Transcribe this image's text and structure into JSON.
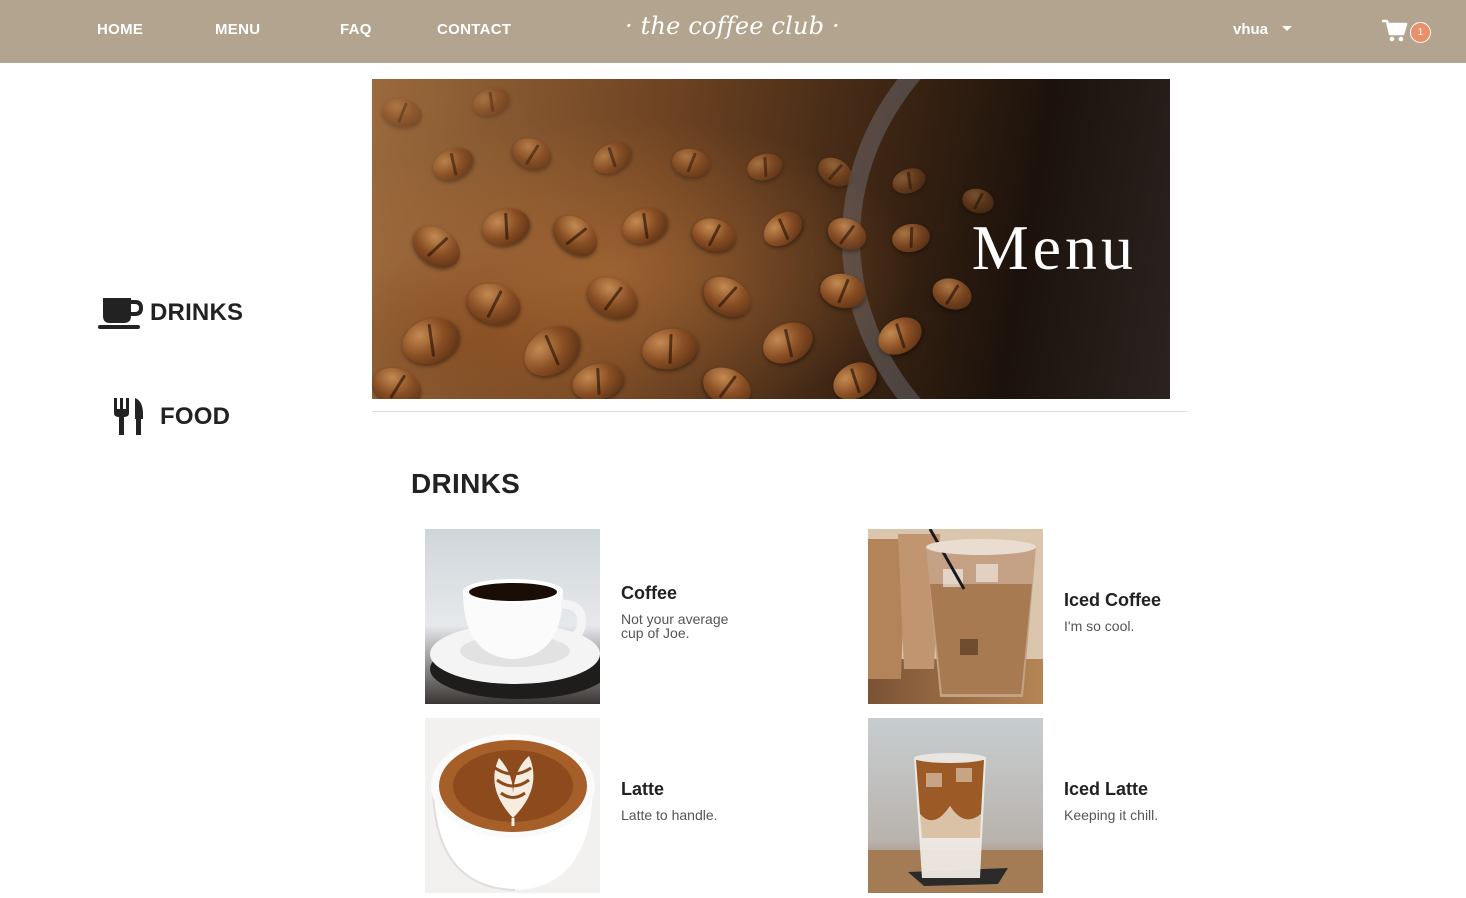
{
  "nav": {
    "links": [
      "HOME",
      "MENU",
      "FAQ",
      "CONTACT"
    ],
    "brand": "· the coffee club ·",
    "user": "vhua",
    "cart_count": "1",
    "bar_color": "#b3a48f",
    "badge_color": "#e8906a"
  },
  "sidebar": {
    "items": [
      {
        "label": "DRINKS",
        "icon": "coffee-cup-icon"
      },
      {
        "label": "FOOD",
        "icon": "utensils-icon"
      }
    ]
  },
  "hero": {
    "title": "Menu"
  },
  "section": {
    "title": "DRINKS"
  },
  "drinks": [
    {
      "name": "Coffee",
      "desc": "Not your average cup of Joe.",
      "image": "coffee-cup-image"
    },
    {
      "name": "Iced Coffee",
      "desc": "I'm so cool.",
      "image": "iced-coffee-image"
    },
    {
      "name": "Latte",
      "desc": "Latte to handle.",
      "image": "latte-art-image"
    },
    {
      "name": "Iced Latte",
      "desc": "Keeping it chill.",
      "image": "iced-latte-image"
    }
  ]
}
